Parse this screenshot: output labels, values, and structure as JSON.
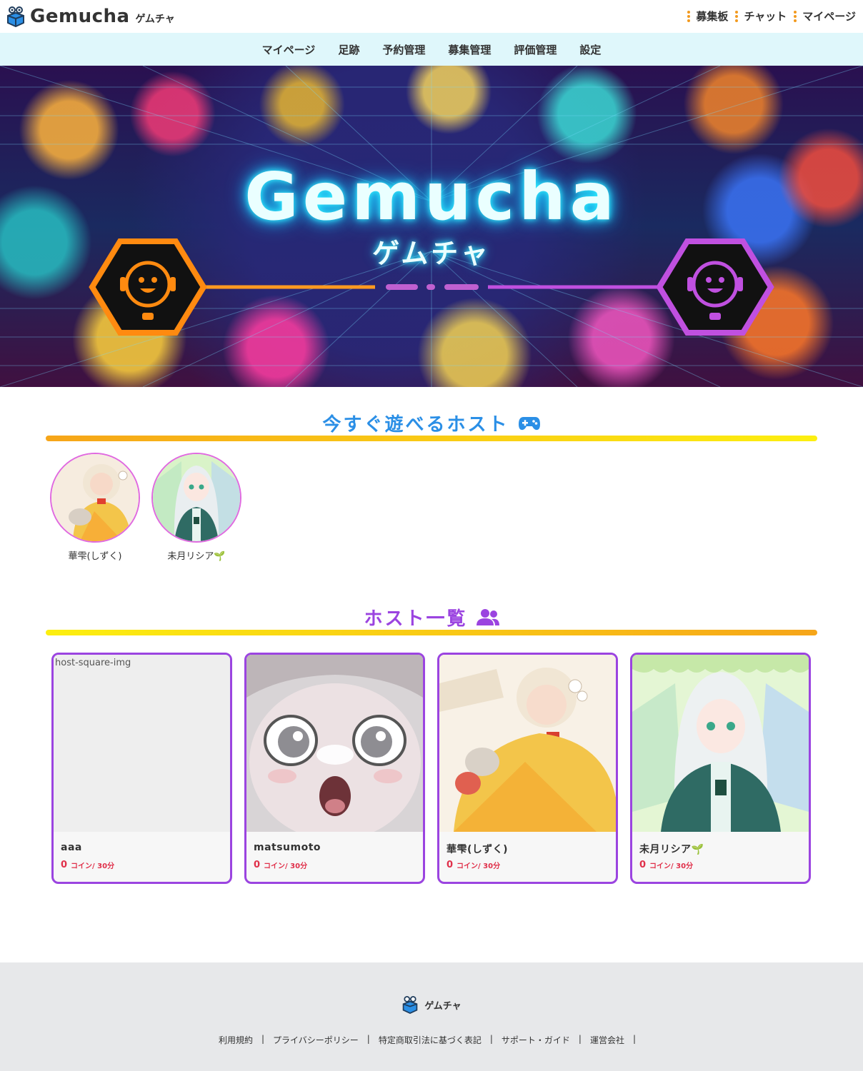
{
  "header": {
    "logo_word": "Gemucha",
    "logo_kana": "ゲムチャ",
    "nav": [
      "募集板",
      "チャット",
      "マイページ"
    ]
  },
  "subnav": [
    "マイページ",
    "足跡",
    "予約管理",
    "募集管理",
    "評価管理",
    "設定"
  ],
  "hero": {
    "title": "Gemucha",
    "subtitle": "ゲムチャ"
  },
  "available": {
    "title": "今すぐ遊べるホスト",
    "hosts": [
      {
        "name": "華雫(しずく)"
      },
      {
        "name": "未月リシア🌱"
      }
    ]
  },
  "host_list": {
    "title": "ホスト一覧",
    "cards": [
      {
        "name": "aaa",
        "coins": "0",
        "price_text": "コイン/ 30分",
        "image_alt": "host-square-img"
      },
      {
        "name": "matsumoto",
        "coins": "0",
        "price_text": "コイン/ 30分"
      },
      {
        "name": "華雫(しずく)",
        "coins": "0",
        "price_text": "コイン/ 30分"
      },
      {
        "name": "未月リシア🌱",
        "coins": "0",
        "price_text": "コイン/ 30分"
      }
    ]
  },
  "footer": {
    "logo_text": "ゲムチャ",
    "links": [
      "利用規約",
      "プライバシーポリシー",
      "特定商取引法に基づく表記",
      "サポート・ガイド",
      "運営会社"
    ]
  },
  "colors": {
    "accent_blue": "#2b8fe6",
    "accent_purple": "#9b44e0",
    "orange": "#f29a1f",
    "price_red": "#e0304a"
  }
}
